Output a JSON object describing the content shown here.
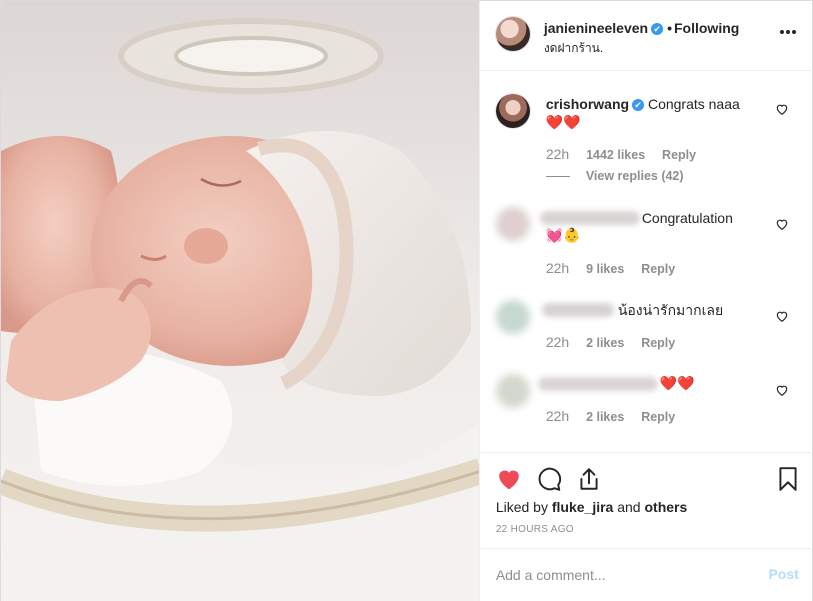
{
  "post": {
    "username": "janienineeleven",
    "verified_mark": "✔",
    "separator": "•",
    "follow_status": "Following",
    "location": "งดฝากร้าน."
  },
  "comments": [
    {
      "username": "crishorwang",
      "verified_mark": "✔",
      "text": "Congrats naaa",
      "emoji": "❤️❤️",
      "time": "22h",
      "likes": "1442 likes",
      "reply_label": "Reply",
      "view_replies": "View replies (42)"
    },
    {
      "text": "Congratulation",
      "emoji": "💓👶",
      "time": "22h",
      "likes": "9 likes",
      "reply_label": "Reply"
    },
    {
      "text": "น้องน่ารักมากเลย",
      "time": "22h",
      "likes": "2 likes",
      "reply_label": "Reply"
    },
    {
      "emoji": "❤️❤️",
      "time": "22h",
      "likes": "2 likes",
      "reply_label": "Reply"
    }
  ],
  "actions": {
    "liked_prefix": "Liked by",
    "liked_user": "fluke_jira",
    "liked_and": "and",
    "liked_others": "others",
    "time_ago": "22 HOURS AGO"
  },
  "add_comment": {
    "placeholder": "Add a comment...",
    "post_label": "Post"
  },
  "icons": {
    "more": "more-options-icon",
    "like": "heart-filled-icon",
    "comment": "comment-bubble-icon",
    "share": "share-icon",
    "save": "bookmark-icon",
    "comment_like": "heart-outline-icon"
  },
  "colors": {
    "like_red": "#ed4956",
    "verified_blue": "#3897f0",
    "muted": "#8e8e8e",
    "post_disabled": "#b2dffc"
  }
}
